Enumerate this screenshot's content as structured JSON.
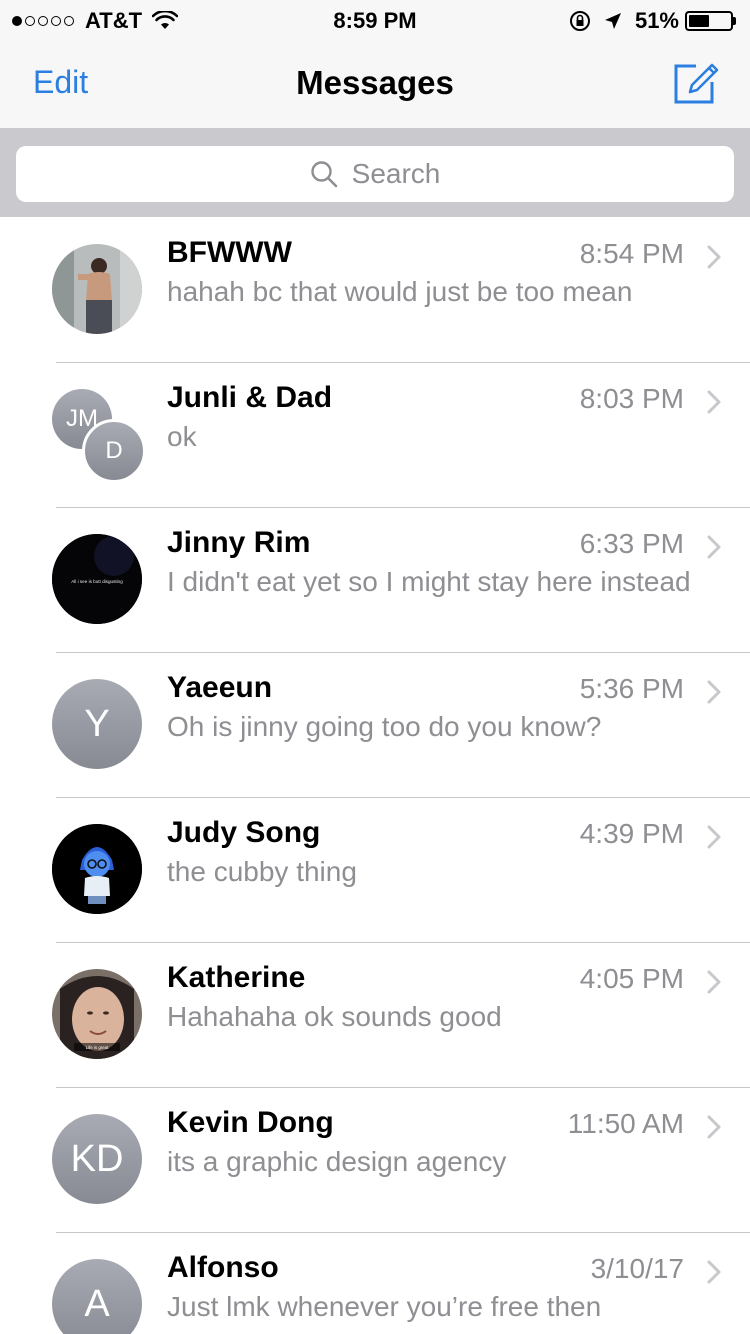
{
  "status_bar": {
    "carrier": "AT&T",
    "signal_bars_filled": 1,
    "signal_bars_total": 5,
    "time": "8:59 PM",
    "battery_percent": "51%",
    "battery_level": 0.51,
    "icons": [
      "wifi-icon",
      "rotation-lock-icon",
      "location-arrow-icon",
      "battery-icon"
    ]
  },
  "nav": {
    "edit_label": "Edit",
    "title": "Messages",
    "compose_icon": "compose-icon"
  },
  "search": {
    "placeholder": "Search",
    "icon": "search-icon"
  },
  "colors": {
    "accent": "#2b7fe0",
    "secondary_text": "#8e8e93",
    "separator": "#c8c7cc",
    "search_background": "#c9c9ce"
  },
  "conversations": [
    {
      "name": "BFWWW",
      "time": "8:54 PM",
      "preview": "hahah bc that would just be too mean",
      "avatar": "photo"
    },
    {
      "name": "Junli & Dad",
      "time": "8:03 PM",
      "preview": "ok",
      "avatar": "group",
      "initials": [
        "JM",
        "D"
      ]
    },
    {
      "name": "Jinny Rim",
      "time": "6:33 PM",
      "preview": "I didn't eat yet so I might stay here instead",
      "avatar": "photo",
      "avatar_caption": "All i see is butt disgusting"
    },
    {
      "name": "Yaeeun",
      "time": "5:36 PM",
      "preview": "Oh is jinny going too do you know?",
      "avatar": "initials",
      "initials": "Y"
    },
    {
      "name": "Judy Song",
      "time": "4:39 PM",
      "preview": "the cubby thing",
      "avatar": "photo"
    },
    {
      "name": "Katherine",
      "time": "4:05 PM",
      "preview": "Hahahaha ok sounds good",
      "avatar": "photo",
      "avatar_caption": "Life is great"
    },
    {
      "name": "Kevin Dong",
      "time": "11:50 AM",
      "preview": "its a graphic design agency",
      "avatar": "initials",
      "initials": "KD"
    },
    {
      "name": "Alfonso",
      "time": "3/10/17",
      "preview": "Just lmk whenever you’re free then",
      "avatar": "initials",
      "initials": "A"
    }
  ]
}
